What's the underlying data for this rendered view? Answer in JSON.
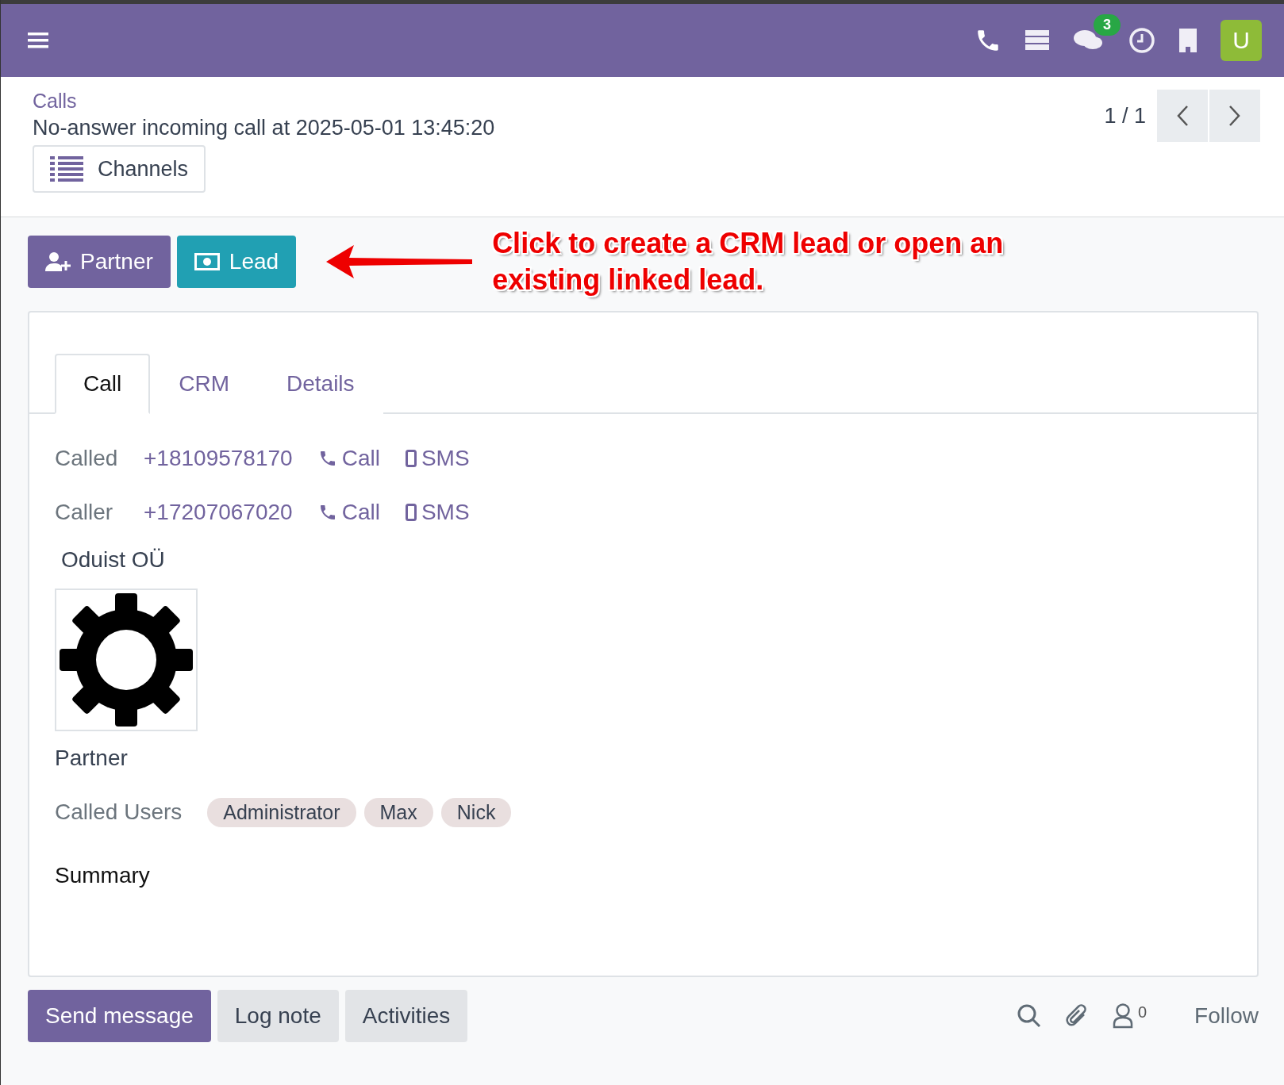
{
  "navbar": {
    "messages_badge": "3",
    "avatar_letter": "U"
  },
  "breadcrumb": {
    "parent": "Calls",
    "title": "No-answer incoming call at 2025-05-01 13:45:20"
  },
  "pager": {
    "value": "1 / 1"
  },
  "smart_button": {
    "label": "Channels"
  },
  "action_buttons": [
    {
      "label": "Partner",
      "kind": "partner"
    },
    {
      "label": "Lead",
      "kind": "lead"
    }
  ],
  "annotation": {
    "text": "Click to create a CRM lead or open an existing linked lead."
  },
  "tabs": [
    {
      "label": "Call",
      "selected": true
    },
    {
      "label": "CRM",
      "selected": false
    },
    {
      "label": "Details",
      "selected": false
    }
  ],
  "phone_rows": [
    {
      "label": "Called",
      "number": "+18109578170",
      "call": "Call",
      "sms": "SMS"
    },
    {
      "label": "Caller",
      "number": "+17207067020",
      "call": "Call",
      "sms": "SMS"
    }
  ],
  "company": "Oduist OÜ",
  "partner_label": "Partner",
  "called_users": {
    "label": "Called Users",
    "tags": [
      "Administrator",
      "Max",
      "Nick"
    ]
  },
  "summary_label": "Summary",
  "chatter": {
    "buttons": [
      {
        "label": "Send message",
        "selected": true
      },
      {
        "label": "Log note",
        "selected": false
      },
      {
        "label": "Activities",
        "selected": false
      }
    ],
    "followers_count": "0",
    "follow": "Follow"
  }
}
